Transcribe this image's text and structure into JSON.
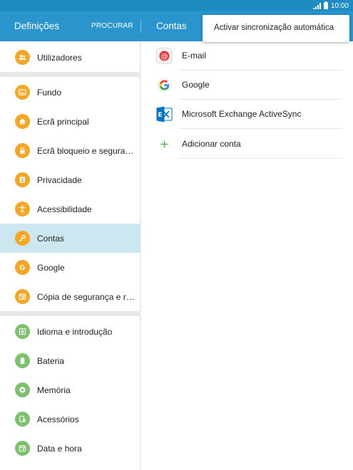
{
  "status_bar": {
    "time": "10:00"
  },
  "app_bar": {
    "title": "Definições",
    "search_label": "PROCURAR",
    "section_title": "Contas"
  },
  "colors": {
    "accent": "#2a94cc",
    "status_bar": "#1e8cc3",
    "selected_bg": "#cde7f1",
    "orange_icon": "#f5a623",
    "green_icon": "#7cc16c",
    "email_red": "#e53935",
    "exchange_blue": "#0072c6"
  },
  "settings_menu": {
    "items": [
      {
        "label": "Utilizadores",
        "icon": "users-icon"
      },
      {
        "label": "Fundo",
        "icon": "wallpaper-icon"
      },
      {
        "label": "Ecrã principal",
        "icon": "home-icon"
      },
      {
        "label": "Ecrã bloqueio e segura…",
        "icon": "lock-icon"
      },
      {
        "label": "Privacidade",
        "icon": "privacy-icon"
      },
      {
        "label": "Acessibilidade",
        "icon": "accessibility-icon"
      },
      {
        "label": "Contas",
        "icon": "key-icon",
        "selected": true
      },
      {
        "label": "Google",
        "icon": "google-icon"
      },
      {
        "label": "Cópia de segurança e r…",
        "icon": "backup-icon"
      },
      {
        "label": "Idioma e introdução",
        "icon": "language-icon"
      },
      {
        "label": "Bateria",
        "icon": "battery-icon"
      },
      {
        "label": "Memória",
        "icon": "memory-icon"
      },
      {
        "label": "Acessórios",
        "icon": "accessories-icon"
      },
      {
        "label": "Data e hora",
        "icon": "calendar-icon"
      }
    ]
  },
  "accounts": {
    "items": [
      {
        "label": "E-mail",
        "icon": "email-icon"
      },
      {
        "label": "Google",
        "icon": "google-g-icon"
      },
      {
        "label": "Microsoft Exchange ActiveSync",
        "icon": "exchange-icon"
      },
      {
        "label": "Adicionar conta",
        "icon": "plus-icon"
      }
    ]
  },
  "popup_menu": {
    "items": [
      {
        "label": "Activar sincronização automática"
      }
    ]
  }
}
